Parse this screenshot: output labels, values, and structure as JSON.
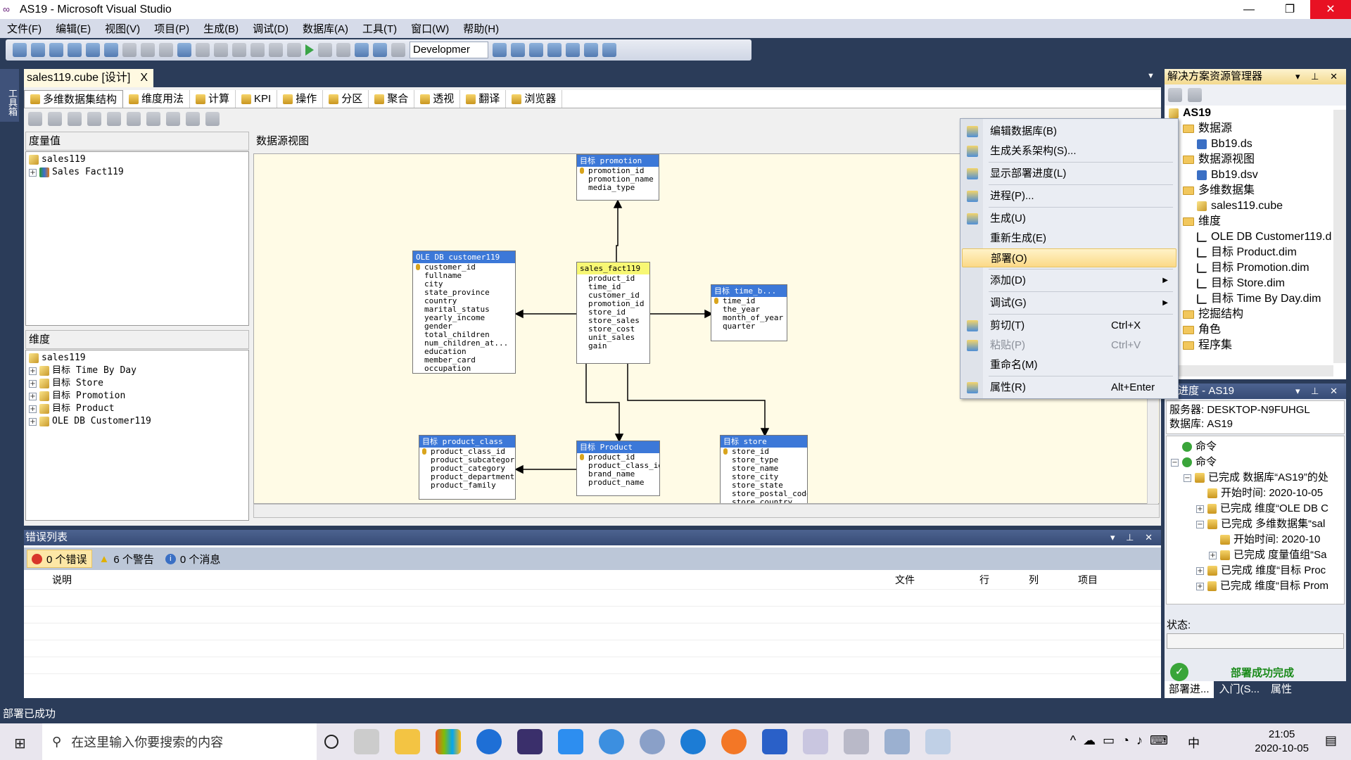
{
  "window": {
    "title": "AS19 - Microsoft Visual Studio",
    "minimize": "—",
    "restore": "❐",
    "close": "✕"
  },
  "menu": [
    "文件(F)",
    "编辑(E)",
    "视图(V)",
    "项目(P)",
    "生成(B)",
    "调试(D)",
    "数据库(A)",
    "工具(T)",
    "窗口(W)",
    "帮助(H)"
  ],
  "toolbar": {
    "config": "Developmer"
  },
  "toolbox": {
    "label": "工具箱"
  },
  "doc_tab": {
    "label": "sales119.cube [设计]",
    "close": "X"
  },
  "sub_tabs": [
    "多维数据集结构",
    "维度用法",
    "计算",
    "KPI",
    "操作",
    "分区",
    "聚合",
    "透视",
    "翻译",
    "浏览器"
  ],
  "measures": {
    "header": "度量值",
    "root": "sales119",
    "items": [
      "Sales Fact119"
    ]
  },
  "dimensions": {
    "header": "维度",
    "root": "sales119",
    "items": [
      "目标 Time By Day",
      "目标 Store",
      "目标 Promotion",
      "目标 Product",
      "OLE DB Customer119"
    ]
  },
  "dsv": {
    "header": "数据源视图",
    "tables": [
      {
        "title": "目标 promotion",
        "columns": [
          "promotion_id",
          "promotion_name",
          "media_type"
        ],
        "key": 0
      },
      {
        "title": "OLE DB customer119",
        "columns": [
          "customer_id",
          "fullname",
          "city",
          "state_province",
          "country",
          "marital_status",
          "yearly_income",
          "gender",
          "total_children",
          "num_children_at...",
          "education",
          "member_card",
          "occupation"
        ],
        "key": 0
      },
      {
        "title": "sales_fact119",
        "columns": [
          "product_id",
          "time_id",
          "customer_id",
          "promotion_id",
          "store_id",
          "store_sales",
          "store_cost",
          "unit_sales",
          "gain"
        ],
        "key": -1,
        "fact": true
      },
      {
        "title": "目标 time_b...",
        "columns": [
          "time_id",
          "the_year",
          "month_of_year",
          "quarter"
        ],
        "key": 0
      },
      {
        "title": "目标 product_class",
        "columns": [
          "product_class_id",
          "product_subcategory",
          "product_category",
          "product_department",
          "product_family"
        ],
        "key": 0
      },
      {
        "title": "目标 Product",
        "columns": [
          "product_id",
          "product_class_id",
          "brand_name",
          "product_name"
        ],
        "key": 0
      },
      {
        "title": "目标 store",
        "columns": [
          "store_id",
          "store_type",
          "store_name",
          "store_city",
          "store_state",
          "store_postal_code",
          "store_country"
        ],
        "key": 0
      }
    ]
  },
  "error_list": {
    "title": "错误列表",
    "errors": "0 个错误",
    "warnings": "6 个警告",
    "messages": "0 个消息",
    "columns": [
      "说明",
      "文件",
      "行",
      "列",
      "项目"
    ]
  },
  "solution_explorer": {
    "title": "解决方案资源管理器",
    "items": [
      {
        "label": "AS19",
        "level": 0,
        "type": "project"
      },
      {
        "label": "数据源",
        "level": 1,
        "type": "folder"
      },
      {
        "label": "Bb19.ds",
        "level": 2,
        "type": "ds"
      },
      {
        "label": "数据源视图",
        "level": 1,
        "type": "folder"
      },
      {
        "label": "Bb19.dsv",
        "level": 2,
        "type": "ds"
      },
      {
        "label": "多维数据集",
        "level": 1,
        "type": "folder"
      },
      {
        "label": "sales119.cube",
        "level": 2,
        "type": "cube"
      },
      {
        "label": "维度",
        "level": 1,
        "type": "folder"
      },
      {
        "label": "OLE DB Customer119.d",
        "level": 2,
        "type": "dim"
      },
      {
        "label": "目标 Product.dim",
        "level": 2,
        "type": "dim"
      },
      {
        "label": "目标 Promotion.dim",
        "level": 2,
        "type": "dim"
      },
      {
        "label": "目标 Store.dim",
        "level": 2,
        "type": "dim"
      },
      {
        "label": "目标 Time By Day.dim",
        "level": 2,
        "type": "dim"
      },
      {
        "label": "挖掘结构",
        "level": 1,
        "type": "folder"
      },
      {
        "label": "角色",
        "level": 1,
        "type": "folder"
      },
      {
        "label": "程序集",
        "level": 1,
        "type": "folder"
      }
    ]
  },
  "context_menu": [
    {
      "label": "编辑数据库(B)",
      "icon": "edit-database-icon"
    },
    {
      "label": "生成关系架构(S)...",
      "icon": "generate-schema-icon",
      "sep_after": true
    },
    {
      "label": "显示部署进度(L)",
      "icon": "deploy-progress-icon",
      "sep_after": true
    },
    {
      "label": "进程(P)...",
      "icon": "process-icon",
      "sep_after": true
    },
    {
      "label": "生成(U)",
      "icon": "build-icon"
    },
    {
      "label": "重新生成(E)"
    },
    {
      "label": "部署(O)",
      "highlighted": true,
      "sep_after": true
    },
    {
      "label": "添加(D)",
      "submenu": true,
      "sep_after": true
    },
    {
      "label": "调试(G)",
      "submenu": true,
      "sep_after": true
    },
    {
      "label": "剪切(T)",
      "shortcut": "Ctrl+X",
      "icon": "scissors-icon"
    },
    {
      "label": "粘贴(P)",
      "shortcut": "Ctrl+V",
      "icon": "paste-icon",
      "disabled": true
    },
    {
      "label": "重命名(M)",
      "sep_after": true
    },
    {
      "label": "属性(R)",
      "shortcut": "Alt+Enter",
      "icon": "properties-icon"
    }
  ],
  "deploy_progress": {
    "title": "署进度 - AS19",
    "server": "服务器: DESKTOP-N9FUHGL",
    "database": "数据库: AS19",
    "items": [
      {
        "label": "命令",
        "level": 0,
        "pm": ""
      },
      {
        "label": "命令",
        "level": 0,
        "pm": "−"
      },
      {
        "label": "已完成 数据库“AS19”的处",
        "level": 1,
        "pm": "−"
      },
      {
        "label": "开始时间: 2020-10-05",
        "level": 2,
        "pm": ""
      },
      {
        "label": "已完成 维度“OLE DB C",
        "level": 2,
        "pm": "+"
      },
      {
        "label": "已完成 多维数据集“sal",
        "level": 2,
        "pm": "−"
      },
      {
        "label": "开始时间: 2020-10",
        "level": 3,
        "pm": ""
      },
      {
        "label": "已完成 度量值组“Sa",
        "level": 3,
        "pm": "+"
      },
      {
        "label": "已完成 维度“目标 Proc",
        "level": 2,
        "pm": "+"
      },
      {
        "label": "已完成 维度“目标 Prom",
        "level": 2,
        "pm": "+"
      }
    ],
    "status_label": "状态:",
    "result": "部署成功完成",
    "result_color": "#1a8a1a",
    "tabs": [
      "部署进...",
      "入门(S...",
      "属性"
    ]
  },
  "status_bar": {
    "text": "部署已成功"
  },
  "taskbar": {
    "search_placeholder": "在这里输入你要搜索的内容",
    "time": "21:05",
    "date": "2020-10-05",
    "ime": "中"
  }
}
